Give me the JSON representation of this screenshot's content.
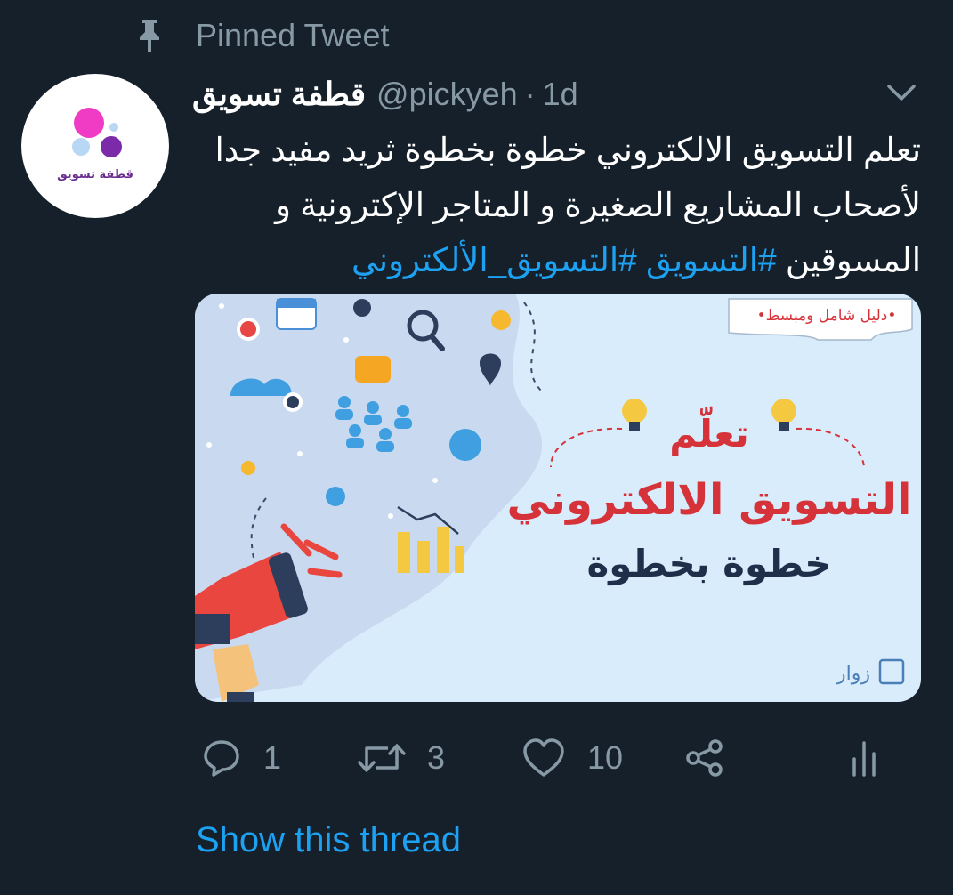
{
  "pinned": {
    "label": "Pinned Tweet",
    "icon": "pin-icon"
  },
  "author": {
    "name": "قطفة تسويق",
    "handle": "@pickyeh",
    "separator": "·",
    "time": "1d",
    "avatar_text": "قطفة تسويق"
  },
  "tweet": {
    "text_plain": "تعلم التسويق الالكتروني خطوة بخطوة ثريد مفيد جدا لأصحاب المشاريع الصغيرة و المتاجر الإكترونية و المسوقين",
    "hashtags": [
      "#التسويق",
      "#التسويق_الألكتروني"
    ]
  },
  "media": {
    "badge": "•دليل شامل ومبسط•",
    "title_line1": "تعلّم",
    "title_line2": "التسويق الالكتروني",
    "title_line3": "خطوة بخطوة",
    "brand": "زوار"
  },
  "actions": {
    "reply_count": "1",
    "retweet_count": "3",
    "like_count": "10"
  },
  "show_thread": "Show this thread",
  "colors": {
    "background": "#15202b",
    "secondary_text": "#8899a6",
    "link": "#1da1f2",
    "megaphone_red": "#e8463f",
    "title_red": "#d6323a",
    "title_navy": "#1f2f4a"
  }
}
